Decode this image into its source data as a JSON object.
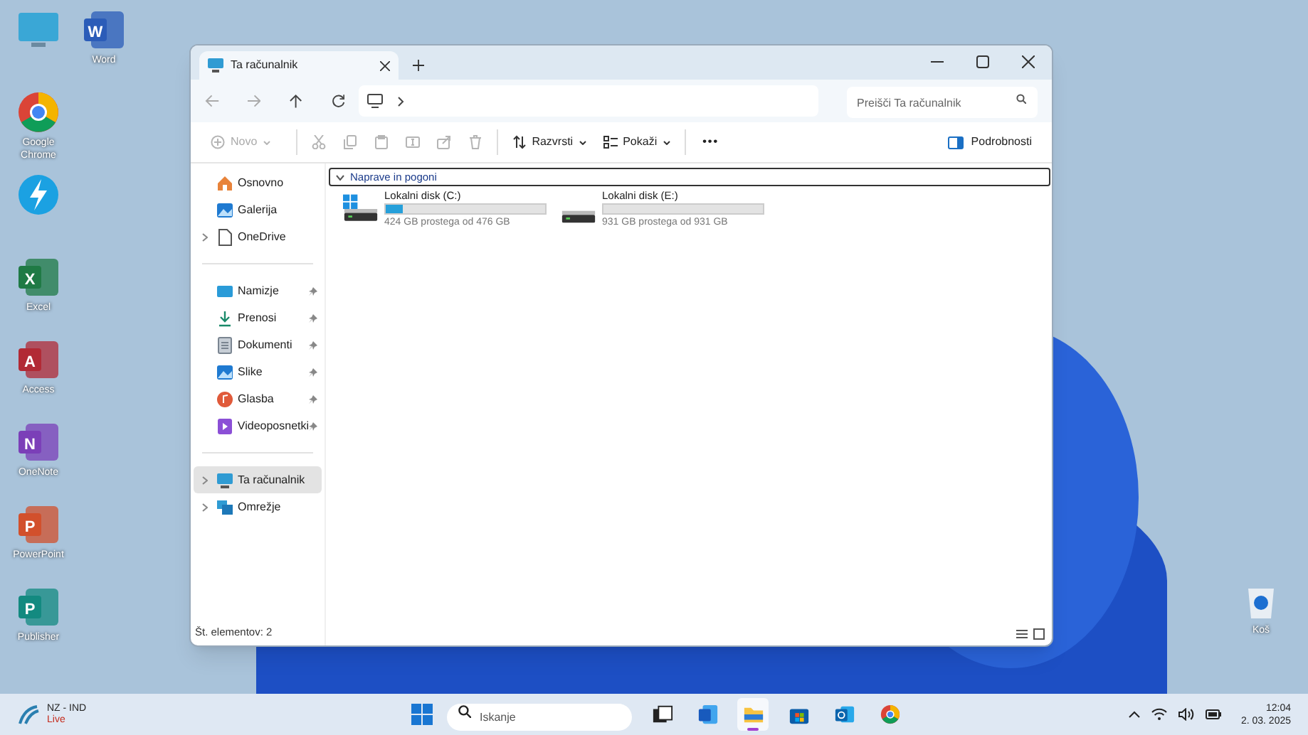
{
  "desktop_icons": [
    {
      "kind": "monitor"
    },
    {
      "kind": "word",
      "label": "Word",
      "letter": "W"
    },
    {
      "kind": "chrome",
      "label": "Google Chrome"
    },
    {
      "kind": "bolt"
    },
    {
      "kind": "excel",
      "label": "Excel",
      "letter": "X"
    },
    {
      "kind": "access",
      "label": "Access",
      "letter": "A"
    },
    {
      "kind": "onenote",
      "label": "OneNote",
      "letter": "N"
    },
    {
      "kind": "powerpoint",
      "label": "PowerPoint",
      "letter": "P"
    },
    {
      "kind": "publisher",
      "label": "Publisher",
      "letter": "P"
    }
  ],
  "recycle_bin": {
    "label": "Koš"
  },
  "window": {
    "tabs": [
      {
        "title": "Ta računalnik",
        "selected": true
      }
    ],
    "search": {
      "placeholder": "Preišči Ta računalnik"
    },
    "toolbar": [
      {
        "kind": "new",
        "label": "Novo",
        "disabled": true
      },
      {
        "kind": "cut",
        "disabled": true
      },
      {
        "kind": "copy",
        "disabled": true
      },
      {
        "kind": "paste",
        "disabled": true
      },
      {
        "kind": "rename",
        "disabled": true
      },
      {
        "kind": "share",
        "disabled": true
      },
      {
        "kind": "delete",
        "disabled": true
      },
      {
        "kind": "sort",
        "label": "Razvrsti",
        "disabled": false
      },
      {
        "kind": "view",
        "label": "Pokaži",
        "disabled": false
      },
      {
        "kind": "more",
        "label": "•••",
        "disabled": false
      }
    ],
    "details_button": "Podrobnosti",
    "sidebar": [
      {
        "kind": "home",
        "label": "Osnovno",
        "pinned": false,
        "selected": false,
        "expandable": false,
        "separator_before": false
      },
      {
        "kind": "gallery",
        "label": "Galerija",
        "pinned": false,
        "selected": false,
        "expandable": false,
        "separator_before": false
      },
      {
        "kind": "doc",
        "label": "OneDrive",
        "pinned": false,
        "selected": false,
        "expandable": true,
        "separator_before": false
      },
      {
        "kind": "desktop",
        "label": "Namizje",
        "pinned": true,
        "selected": false,
        "expandable": false,
        "separator_before": true
      },
      {
        "kind": "download",
        "label": "Prenosi",
        "pinned": true,
        "selected": false,
        "expandable": false,
        "separator_before": false
      },
      {
        "kind": "docs",
        "label": "Dokumenti",
        "pinned": true,
        "selected": false,
        "expandable": false,
        "separator_before": false
      },
      {
        "kind": "gallery",
        "label": "Slike",
        "pinned": true,
        "selected": false,
        "expandable": false,
        "separator_before": false
      },
      {
        "kind": "music",
        "label": "Glasba",
        "pinned": true,
        "selected": false,
        "expandable": false,
        "separator_before": false
      },
      {
        "kind": "video",
        "label": "Videoposnetki",
        "pinned": true,
        "selected": false,
        "expandable": false,
        "separator_before": false
      },
      {
        "kind": "pc",
        "label": "Ta računalnik",
        "pinned": false,
        "selected": true,
        "expandable": true,
        "separator_before": true
      },
      {
        "kind": "network",
        "label": "Omrežje",
        "pinned": false,
        "selected": false,
        "expandable": true,
        "separator_before": false
      }
    ],
    "group": {
      "title": "Naprave in pogoni",
      "expanded": true
    },
    "drives": [
      {
        "name": "Lokalni disk (C:)",
        "level": 0.11,
        "reading": "424 GB prostega od 476 GB",
        "system": true
      },
      {
        "name": "Lokalni disk (E:)",
        "level": 0.0,
        "reading": "931 GB prostega od 931 GB",
        "system": false
      }
    ],
    "status_bar": "Št. elementov: 2"
  },
  "taskbar": {
    "weather": {
      "title": "NZ - IND",
      "subtitle": "Live"
    },
    "search_placeholder": "Iskanje",
    "apps": [
      {
        "kind": "taskview",
        "selected": false
      },
      {
        "kind": "word",
        "selected": false
      },
      {
        "kind": "explorer",
        "selected": true
      },
      {
        "kind": "store",
        "selected": false
      },
      {
        "kind": "outlook",
        "selected": false
      },
      {
        "kind": "chrome",
        "selected": false
      }
    ],
    "time": "12:04",
    "date": "2. 03. 2025"
  }
}
